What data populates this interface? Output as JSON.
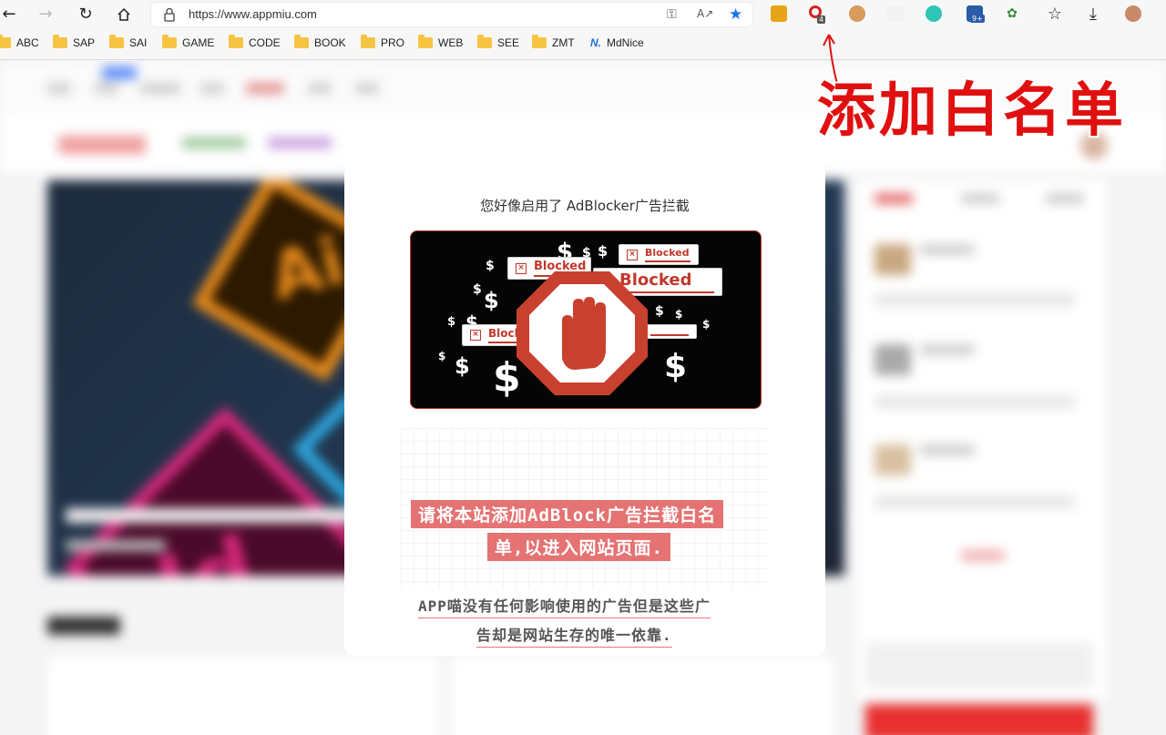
{
  "browser": {
    "url": "https://www.appmiu.com",
    "extension_badge": "4",
    "badge_9plus": "9+",
    "bookmarks": [
      {
        "label": "ABC"
      },
      {
        "label": "SAP"
      },
      {
        "label": "SAI"
      },
      {
        "label": "GAME"
      },
      {
        "label": "CODE"
      },
      {
        "label": "BOOK"
      },
      {
        "label": "PRO"
      },
      {
        "label": "WEB"
      },
      {
        "label": "SEE"
      },
      {
        "label": "ZMT"
      },
      {
        "label": "MdNice"
      }
    ]
  },
  "modal": {
    "title": "您好像启用了 AdBlocker广告拦截",
    "banner_tags": [
      "Blocked",
      "Blocked",
      "Blocked",
      "Blocked"
    ],
    "highlight_line1": "请将本站添加AdBlock广告拦截白名",
    "highlight_line2": "单,以进入网站页面.",
    "plain_line1": "APP喵没有任何影响使用的广告但是这些广",
    "plain_line2": "告却是网站生存的唯一依靠."
  },
  "annotation": {
    "text": "添加白名单"
  },
  "colors": {
    "accent_red": "#e57373",
    "annotation_red": "#e01010",
    "folder_yellow": "#f6c343"
  }
}
